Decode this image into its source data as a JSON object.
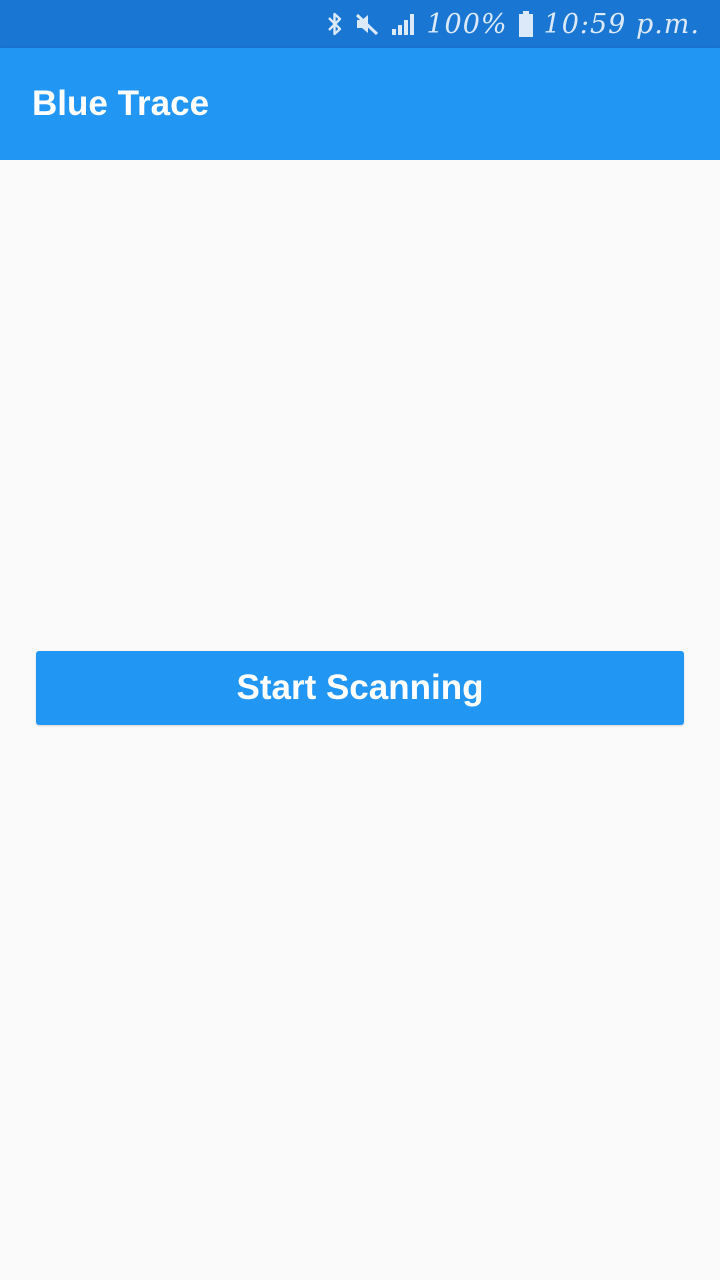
{
  "status_bar": {
    "battery": "100%",
    "time": "10:59 p.m.",
    "icons": [
      "bluetooth-icon",
      "mute-icon",
      "signal-icon",
      "battery-icon"
    ]
  },
  "app_bar": {
    "title": "Blue Trace"
  },
  "main": {
    "start_button_label": "Start Scanning"
  },
  "colors": {
    "status_bar": "#1976d2",
    "primary": "#2196f3",
    "background": "#fafafa",
    "on_primary": "#ffffff"
  }
}
